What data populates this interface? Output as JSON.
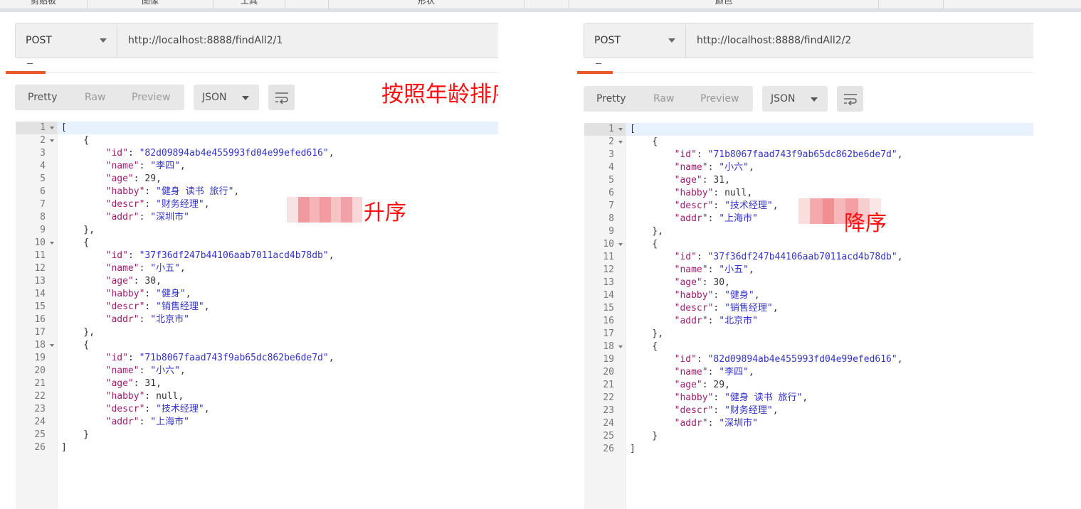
{
  "ribbon": [
    "剪贴板",
    "图像",
    "工具",
    "形状",
    "颜色"
  ],
  "colors": {
    "accent": "#e8582c",
    "annotation": "#ff1010",
    "json_key": "#a01d70",
    "json_string": "#3333c8"
  },
  "left": {
    "method": "POST",
    "url": "http://localhost:8888/findAll2/1",
    "view_tabs": [
      "Pretty",
      "Raw",
      "Preview"
    ],
    "format": "JSON",
    "wrap_icon": "wrap-lines-icon",
    "annotation_title": "按照年龄排序",
    "annotation_order": "升序",
    "records": [
      {
        "id": "82d09894ab4e455993fd04e99efed616",
        "name": "李四",
        "age": "29",
        "habby": "健身 读书 旅行",
        "descr": "财务经理",
        "addr": "深圳市"
      },
      {
        "id": "37f36df247b44106aab7011acd4b78db",
        "name": "小五",
        "age": "30",
        "habby": "健身",
        "descr": "销售经理",
        "addr": "北京市"
      },
      {
        "id": "71b8067faad743f9ab65dc862be6de7d",
        "name": "小六",
        "age": "31",
        "habby": "null",
        "descr": "技术经理",
        "addr": "上海市"
      }
    ]
  },
  "right": {
    "method": "POST",
    "url": "http://localhost:8888/findAll2/2",
    "view_tabs": [
      "Pretty",
      "Raw",
      "Preview"
    ],
    "format": "JSON",
    "wrap_icon": "wrap-lines-icon",
    "annotation_order": "降序",
    "records": [
      {
        "id": "71b8067faad743f9ab65dc862be6de7d",
        "name": "小六",
        "age": "31",
        "habby": "null",
        "descr": "技术经理",
        "addr": "上海市"
      },
      {
        "id": "37f36df247b44106aab7011acd4b78db",
        "name": "小五",
        "age": "30",
        "habby": "健身",
        "descr": "销售经理",
        "addr": "北京市"
      },
      {
        "id": "82d09894ab4e455993fd04e99efed616",
        "name": "李四",
        "age": "29",
        "habby": "健身 读书 旅行",
        "descr": "财务经理",
        "addr": "深圳市"
      }
    ]
  }
}
